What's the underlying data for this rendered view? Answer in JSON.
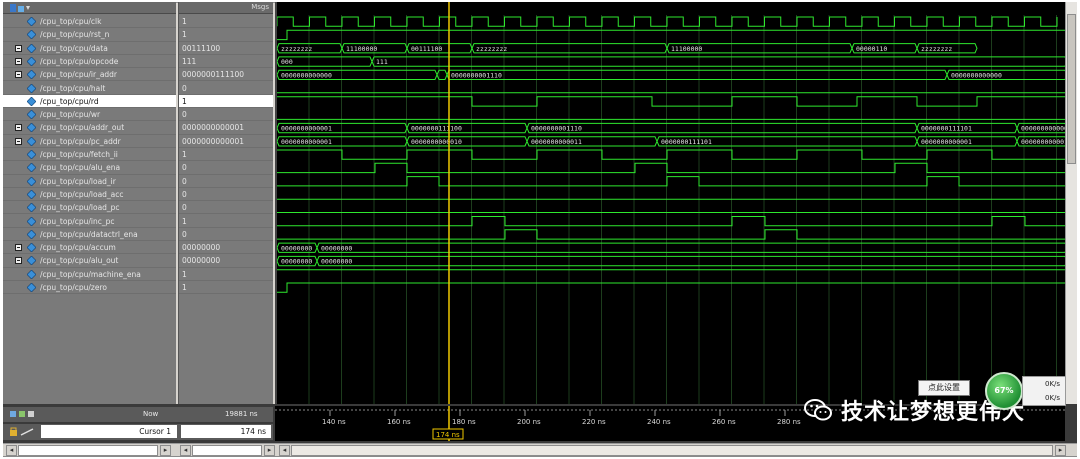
{
  "header": {
    "msgs_label": "Msgs"
  },
  "signals": [
    {
      "name": "/cpu_top/cpu/clk",
      "value": "1",
      "bus": false
    },
    {
      "name": "/cpu_top/cpu/rst_n",
      "value": "1",
      "bus": false
    },
    {
      "name": "/cpu_top/cpu/data",
      "value": "00111100",
      "bus": true
    },
    {
      "name": "/cpu_top/cpu/opcode",
      "value": "111",
      "bus": true
    },
    {
      "name": "/cpu_top/cpu/ir_addr",
      "value": "0000000111100",
      "bus": true
    },
    {
      "name": "/cpu_top/cpu/halt",
      "value": "0",
      "bus": false
    },
    {
      "name": "/cpu_top/cpu/rd",
      "value": "1",
      "bus": false,
      "selected": true
    },
    {
      "name": "/cpu_top/cpu/wr",
      "value": "0",
      "bus": false
    },
    {
      "name": "/cpu_top/cpu/addr_out",
      "value": "0000000000001",
      "bus": true
    },
    {
      "name": "/cpu_top/cpu/pc_addr",
      "value": "0000000000001",
      "bus": true
    },
    {
      "name": "/cpu_top/cpu/fetch_ii",
      "value": "1",
      "bus": false
    },
    {
      "name": "/cpu_top/cpu/alu_ena",
      "value": "0",
      "bus": false
    },
    {
      "name": "/cpu_top/cpu/load_ir",
      "value": "0",
      "bus": false
    },
    {
      "name": "/cpu_top/cpu/load_acc",
      "value": "0",
      "bus": false
    },
    {
      "name": "/cpu_top/cpu/load_pc",
      "value": "0",
      "bus": false
    },
    {
      "name": "/cpu_top/cpu/inc_pc",
      "value": "1",
      "bus": false
    },
    {
      "name": "/cpu_top/cpu/datactrl_ena",
      "value": "0",
      "bus": false
    },
    {
      "name": "/cpu_top/cpu/accum",
      "value": "00000000",
      "bus": true
    },
    {
      "name": "/cpu_top/cpu/alu_out",
      "value": "00000000",
      "bus": true
    },
    {
      "name": "/cpu_top/cpu/machine_ena",
      "value": "1",
      "bus": false
    },
    {
      "name": "/cpu_top/cpu/zero",
      "value": "1",
      "bus": false
    }
  ],
  "waveform_labels": {
    "data": [
      "zzzzzzzz",
      "11100000",
      "00111100",
      "zzzzzzzz",
      "11100000",
      "00000110",
      "zzzzzzzz"
    ],
    "opcode": [
      "000",
      "111"
    ],
    "ir_addr": [
      "0000000000000",
      "0000000111100",
      "0000000001110"
    ],
    "addr_out": [
      "0000000000001",
      "0000000111100",
      "0000000001110",
      "0000000111101"
    ],
    "pc_addr": [
      "0000000000001",
      "0000000000010",
      "0000000000011",
      "0000000111101"
    ],
    "accum": [
      "00000000"
    ],
    "alu_out": [
      "00000000"
    ]
  },
  "cursor": {
    "now_label": "Now",
    "now_value": "19881 ns",
    "cursor_name": "Cursor 1",
    "cursor_value": "174 ns",
    "cursor_marker": "174 ns"
  },
  "time_ticks": [
    "140 ns",
    "160 ns",
    "180 ns",
    "200 ns",
    "220 ns",
    "240 ns",
    "260 ns",
    "280 ns"
  ],
  "overlay": {
    "popup_label": "点此设置",
    "speed_value": "67%",
    "speed_up": "0K/s",
    "speed_down": "0K/s"
  },
  "watermark": {
    "text": "技术让梦想更伟大"
  },
  "colors": {
    "wave": "#2ee82e",
    "cursor": "#f0c800",
    "bus_label": "#e6e6e6",
    "background": "#000000"
  }
}
